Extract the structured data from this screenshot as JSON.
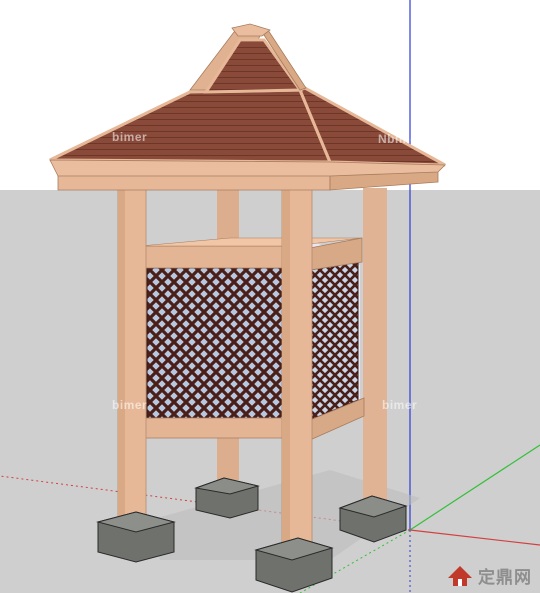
{
  "scene": {
    "title": "",
    "colors": {
      "sky": "#ffffff",
      "ground": "#cfcfcf",
      "wood": "#e6b898",
      "wood_dark": "#c99572",
      "roof_tile": "#8a4a3a",
      "lattice": "#4a1f18",
      "stone": "#6f726c",
      "axis_blue": "#2c3bd6",
      "axis_green": "#33c03a",
      "axis_red": "#d34040"
    }
  },
  "watermarks": {
    "text_1": "bimer",
    "text_2": "Nbimer",
    "text_3": "bimer",
    "text_4": "bimer"
  },
  "brand": {
    "logo_icon": "house-logo-icon",
    "text": "定鼎网"
  }
}
